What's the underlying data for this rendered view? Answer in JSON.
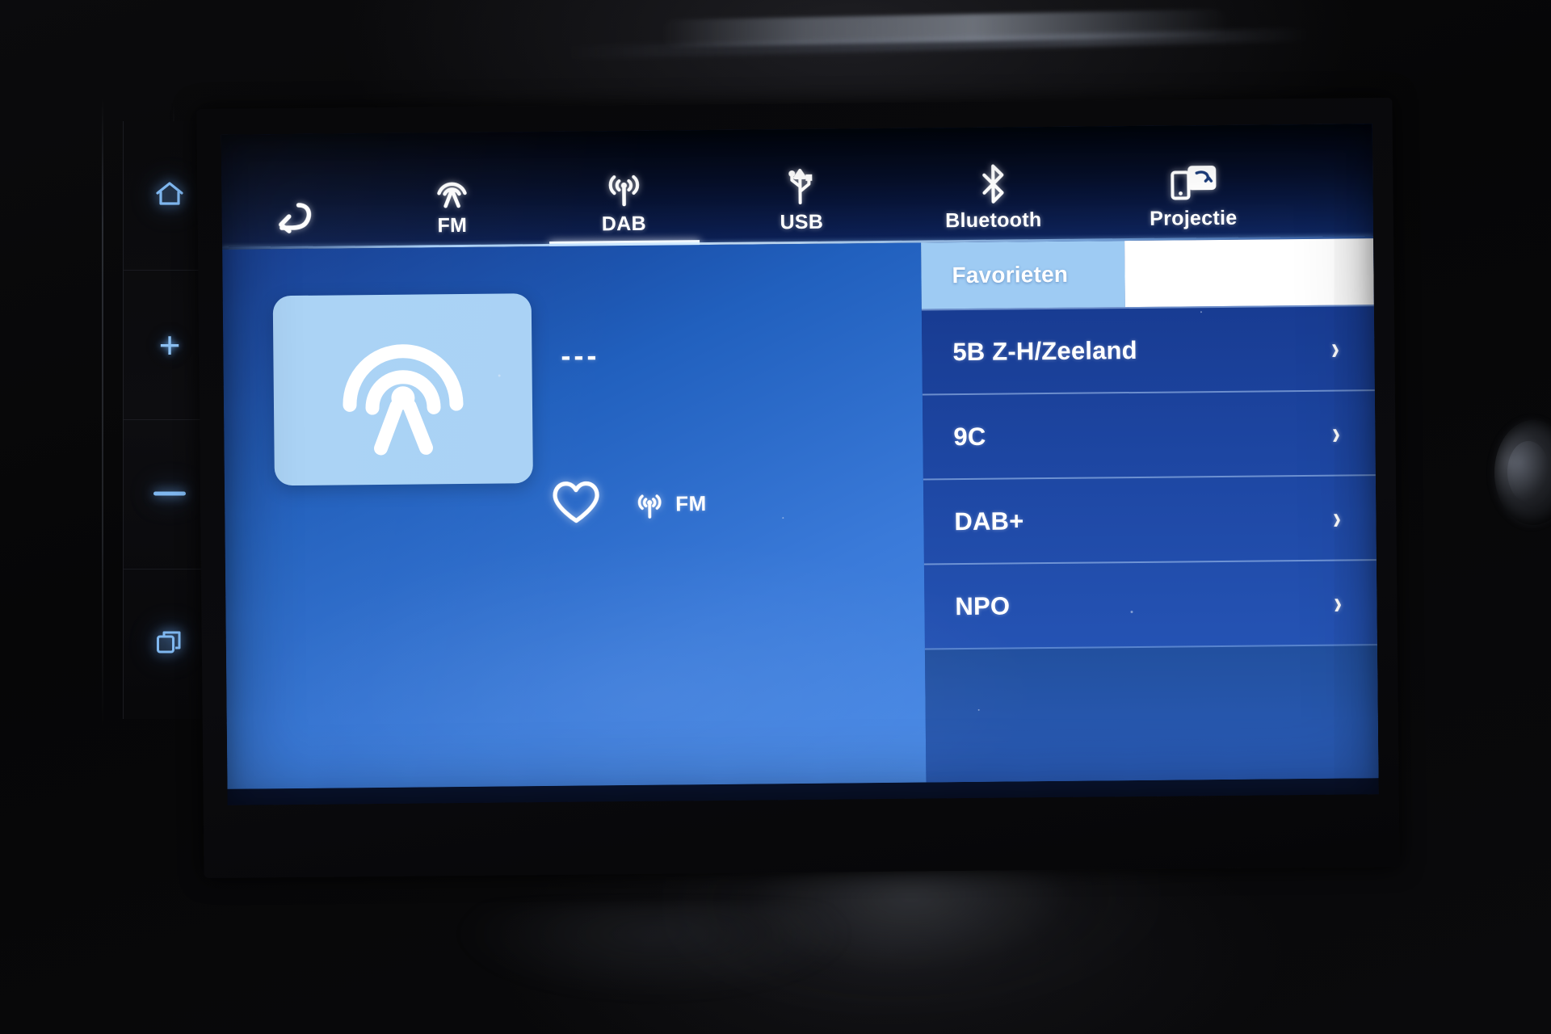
{
  "device": {
    "type": "car-infotainment-head-unit",
    "hardware_buttons": [
      {
        "name": "home",
        "icon": "home-icon",
        "label": ""
      },
      {
        "name": "volume-up",
        "icon": "plus-icon",
        "label": "+"
      },
      {
        "name": "volume-down",
        "icon": "minus-icon",
        "label": "–"
      },
      {
        "name": "app-switcher",
        "icon": "windows-icon",
        "label": ""
      }
    ]
  },
  "tabbar": {
    "back": {
      "label": "",
      "icon": "back-arrow-icon"
    },
    "active_tab": "DAB",
    "tabs": [
      {
        "id": "fm",
        "label": "FM",
        "icon": "radio-tower-icon",
        "active": false
      },
      {
        "id": "dab",
        "label": "DAB",
        "icon": "antenna-waves-icon",
        "active": true
      },
      {
        "id": "usb",
        "label": "USB",
        "icon": "usb-icon",
        "active": false
      },
      {
        "id": "bluetooth",
        "label": "Bluetooth",
        "icon": "bluetooth-icon",
        "active": false
      },
      {
        "id": "projectie",
        "label": "Projectie",
        "icon": "screen-mirror-icon",
        "active": false
      }
    ]
  },
  "now_playing": {
    "artwork_icon": "radio-tower-icon",
    "station_name": "---",
    "favorite_icon": "heart-outline-icon",
    "favorite_active": false,
    "band_icon": "antenna-waves-icon",
    "band_label": "FM"
  },
  "list_panel": {
    "tabs": [
      {
        "id": "favorieten",
        "label": "Favorieten",
        "selected": true
      },
      {
        "id": "blank",
        "label": "",
        "selected": false
      }
    ],
    "rows": [
      {
        "label": "5B Z-H/Zeeland",
        "chevron": "›"
      },
      {
        "label": "9C",
        "chevron": "›"
      },
      {
        "label": "DAB+",
        "chevron": "›"
      },
      {
        "label": "NPO",
        "chevron": "›"
      }
    ]
  },
  "colors": {
    "accent_light_blue": "#9ecbf3",
    "panel_blue": "#1d46a2",
    "content_blue": "#2160be",
    "artwork_bg": "#a9d2f5",
    "white": "#ffffff",
    "hw_glow_blue": "#7fb7ef"
  }
}
